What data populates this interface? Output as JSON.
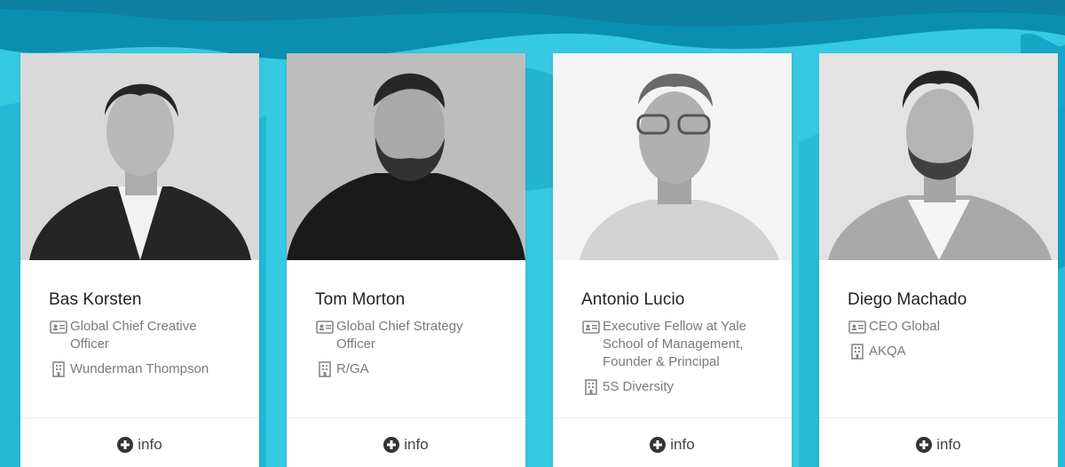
{
  "colors": {
    "background": "#2fc6e0",
    "card": "#ffffff",
    "name": "#222222",
    "meta": "#7a7a7a"
  },
  "icons": {
    "job": "id-card-icon",
    "company": "building-icon",
    "info": "plus-circle-icon"
  },
  "speakers": [
    {
      "name": "Bas Korsten",
      "job_title": "Global Chief Creative Officer",
      "company": "Wunderman Thompson",
      "info_label": "info"
    },
    {
      "name": "Tom Morton",
      "job_title": "Global Chief Strategy Officer",
      "company": "R/GA",
      "info_label": "info"
    },
    {
      "name": "Antonio Lucio",
      "job_title": "Executive Fellow at Yale School of Management, Founder & Principal",
      "company": "5S Diversity",
      "info_label": "info"
    },
    {
      "name": "Diego Machado",
      "job_title": "CEO Global",
      "company": "AKQA",
      "info_label": "info"
    }
  ]
}
